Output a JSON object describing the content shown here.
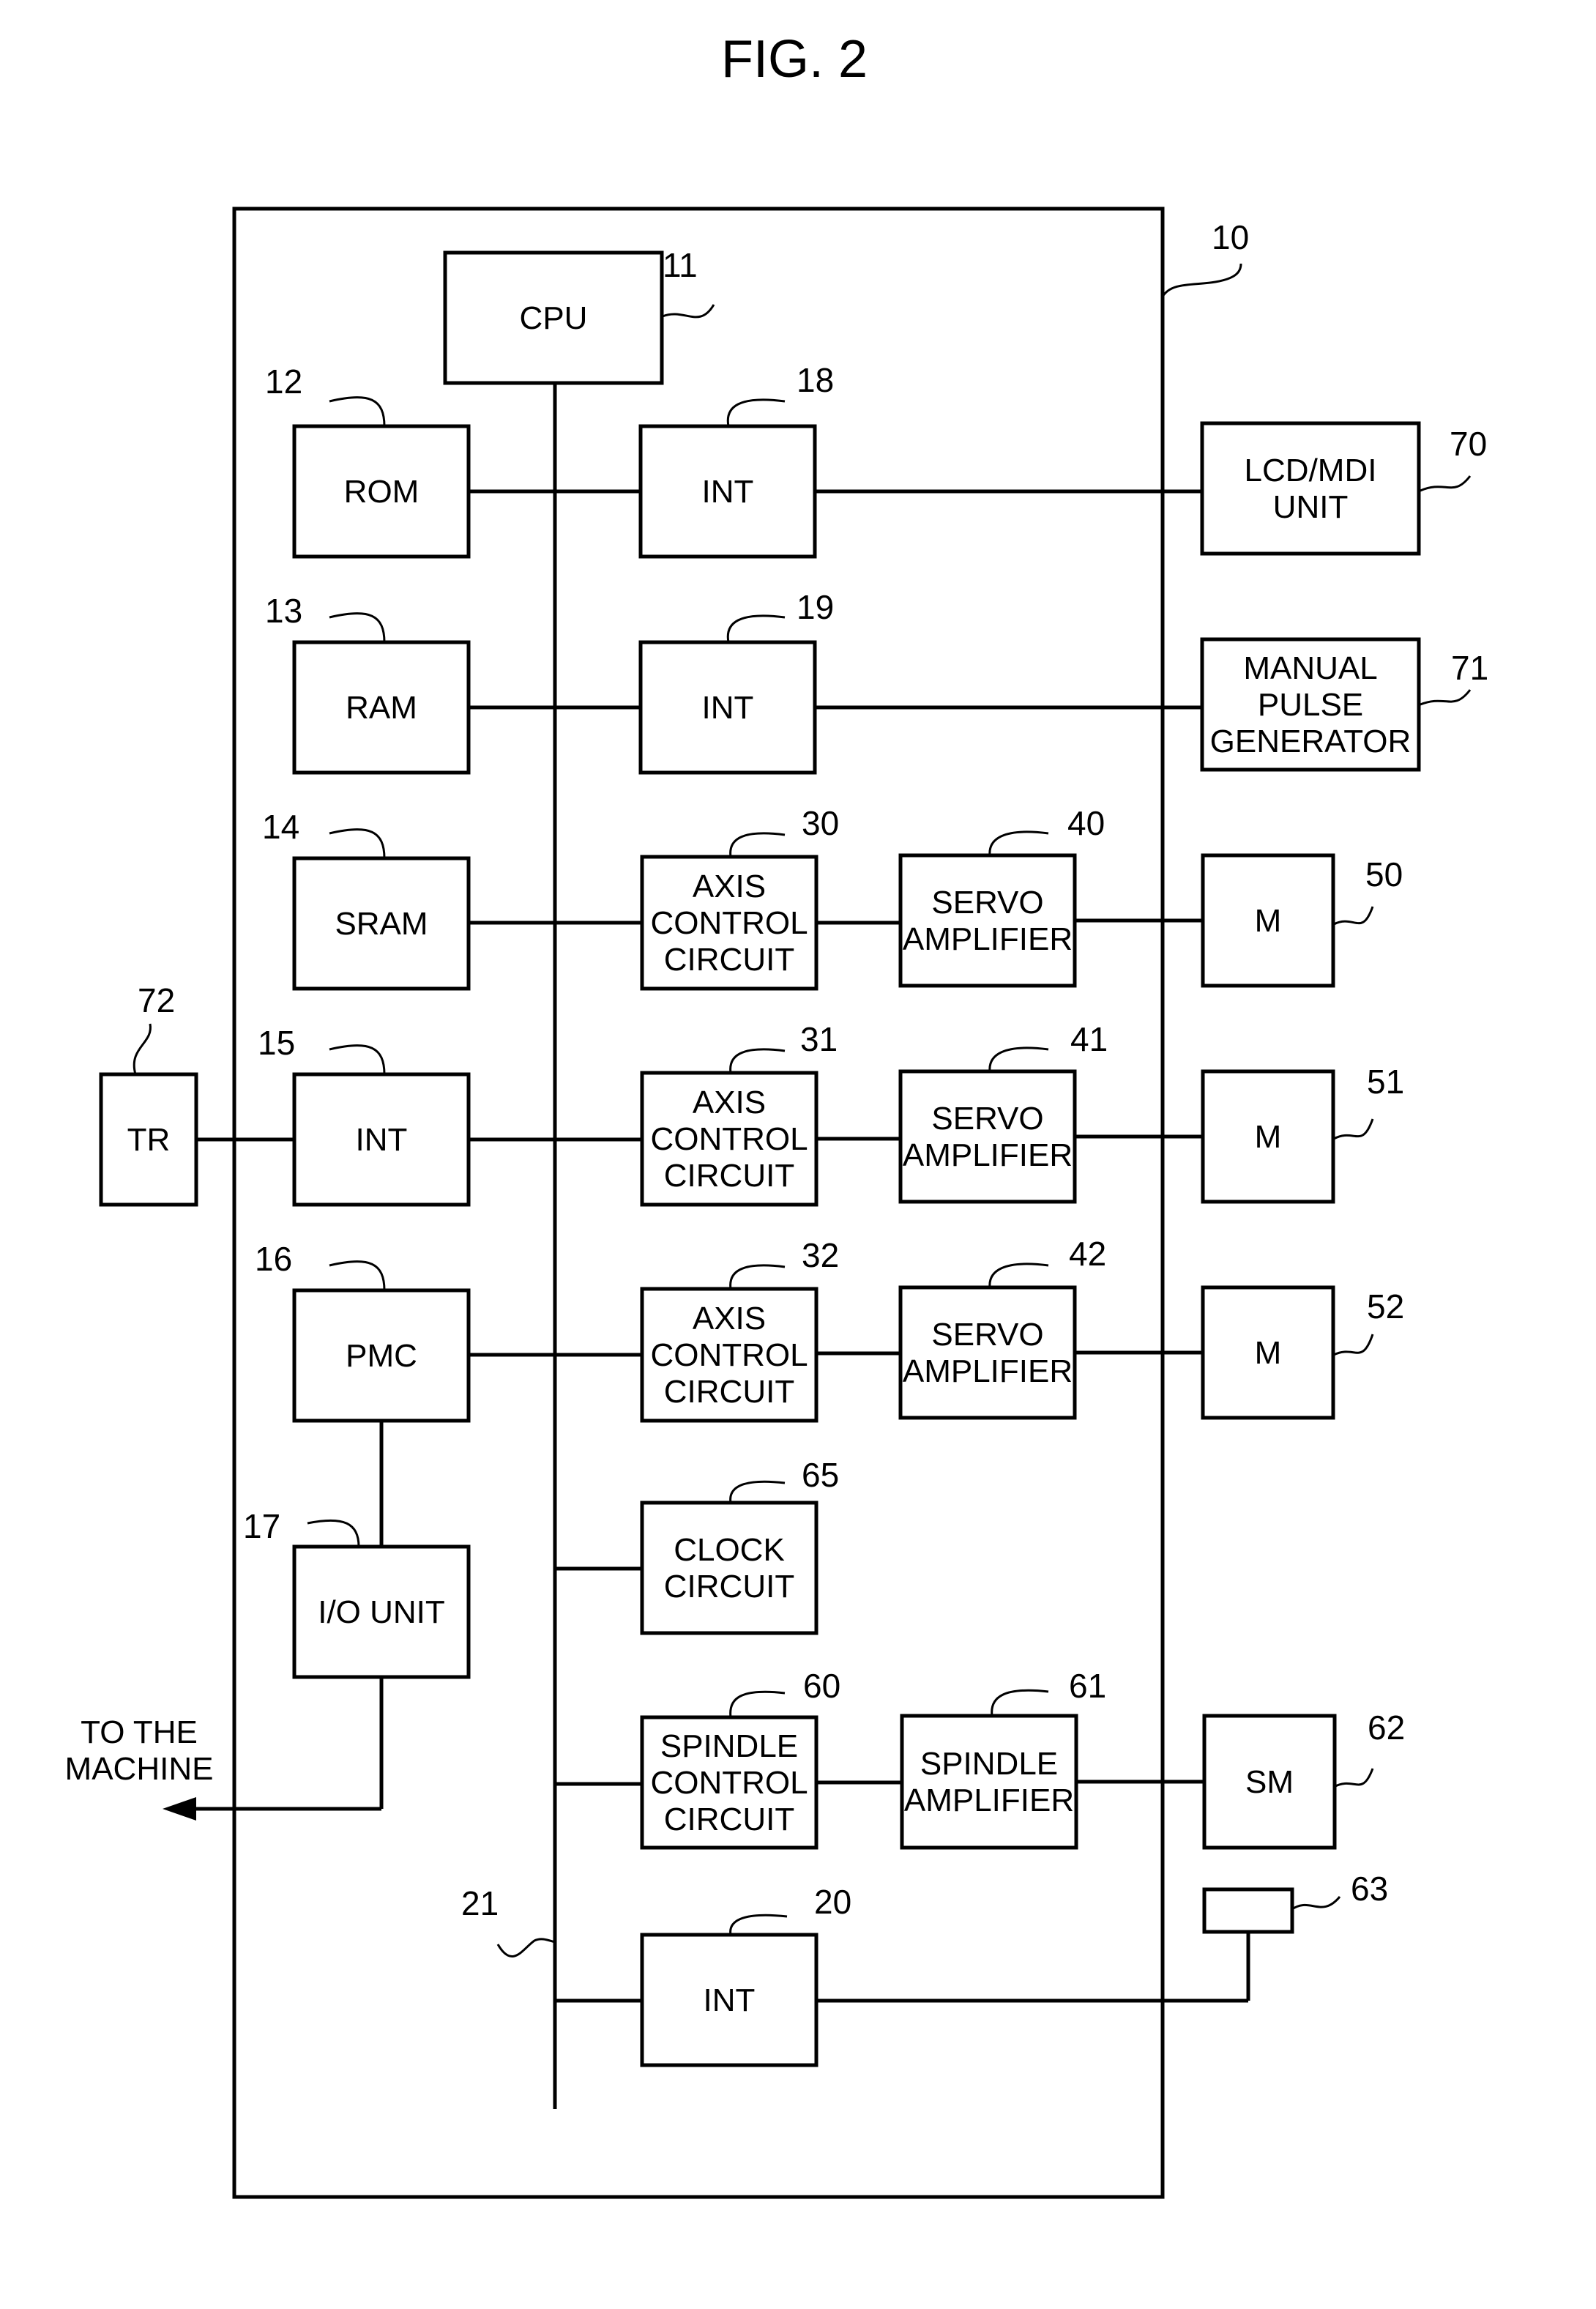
{
  "title": "FIG. 2",
  "controller": {
    "ref": "10"
  },
  "bus": {
    "ref": "21"
  },
  "blocks": {
    "cpu": {
      "ref": "11",
      "lines": [
        "CPU"
      ]
    },
    "rom": {
      "ref": "12",
      "lines": [
        "ROM"
      ]
    },
    "ram": {
      "ref": "13",
      "lines": [
        "RAM"
      ]
    },
    "sram": {
      "ref": "14",
      "lines": [
        "SRAM"
      ]
    },
    "int15": {
      "ref": "15",
      "lines": [
        "INT"
      ]
    },
    "pmc": {
      "ref": "16",
      "lines": [
        "PMC"
      ]
    },
    "io": {
      "ref": "17",
      "lines": [
        "I/O UNIT"
      ]
    },
    "int18": {
      "ref": "18",
      "lines": [
        "INT"
      ]
    },
    "int19": {
      "ref": "19",
      "lines": [
        "INT"
      ]
    },
    "int20": {
      "ref": "20",
      "lines": [
        "INT"
      ]
    },
    "axis30": {
      "ref": "30",
      "lines": [
        "AXIS",
        "CONTROL",
        "CIRCUIT"
      ]
    },
    "axis31": {
      "ref": "31",
      "lines": [
        "AXIS",
        "CONTROL",
        "CIRCUIT"
      ]
    },
    "axis32": {
      "ref": "32",
      "lines": [
        "AXIS",
        "CONTROL",
        "CIRCUIT"
      ]
    },
    "servo40": {
      "ref": "40",
      "lines": [
        "SERVO",
        "AMPLIFIER"
      ]
    },
    "servo41": {
      "ref": "41",
      "lines": [
        "SERVO",
        "AMPLIFIER"
      ]
    },
    "servo42": {
      "ref": "42",
      "lines": [
        "SERVO",
        "AMPLIFIER"
      ]
    },
    "m50": {
      "ref": "50",
      "lines": [
        "M"
      ]
    },
    "m51": {
      "ref": "51",
      "lines": [
        "M"
      ]
    },
    "m52": {
      "ref": "52",
      "lines": [
        "M"
      ]
    },
    "clock": {
      "ref": "65",
      "lines": [
        "CLOCK",
        "CIRCUIT"
      ]
    },
    "spindle_ctrl": {
      "ref": "60",
      "lines": [
        "SPINDLE",
        "CONTROL",
        "CIRCUIT"
      ]
    },
    "spindle_amp": {
      "ref": "61",
      "lines": [
        "SPINDLE",
        "AMPLIFIER"
      ]
    },
    "sm": {
      "ref": "62",
      "lines": [
        "SM"
      ]
    },
    "sensor": {
      "ref": "63",
      "lines": []
    },
    "lcd": {
      "ref": "70",
      "lines": [
        "LCD/MDI",
        "UNIT"
      ]
    },
    "mpg": {
      "ref": "71",
      "lines": [
        "MANUAL",
        "PULSE",
        "GENERATOR"
      ]
    },
    "tr": {
      "ref": "72",
      "lines": [
        "TR"
      ]
    }
  },
  "output_label": [
    "TO THE",
    "MACHINE"
  ]
}
